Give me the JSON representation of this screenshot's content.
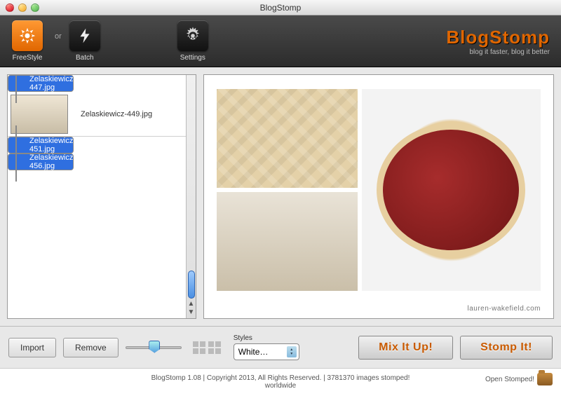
{
  "window": {
    "title": "BlogStomp"
  },
  "toolbar": {
    "freestyle": "FreeStyle",
    "or": "or",
    "batch": "Batch",
    "settings": "Settings",
    "brand": "BlogStomp",
    "tagline": "blog it faster, blog it better"
  },
  "thumbs": [
    {
      "file": "Zelaskiewicz-447.jpg",
      "selected": true
    },
    {
      "file": "Zelaskiewicz-449.jpg",
      "selected": false
    },
    {
      "file": "Zelaskiewicz-451.jpg",
      "selected": true
    },
    {
      "file": "Zelaskiewicz-456.jpg",
      "selected": true
    }
  ],
  "preview": {
    "watermark": "lauren-wakefield.com"
  },
  "bottom": {
    "import": "Import",
    "remove": "Remove",
    "styles_label": "Styles",
    "styles_value": "White…",
    "mix": "Mix It Up!",
    "stomp": "Stomp It!"
  },
  "status": {
    "line1": "BlogStomp 1.08 | Copyright 2013, All Rights Reserved. | 3781370 images stomped!",
    "line2": "worldwide",
    "open_stomped": "Open Stomped!"
  }
}
